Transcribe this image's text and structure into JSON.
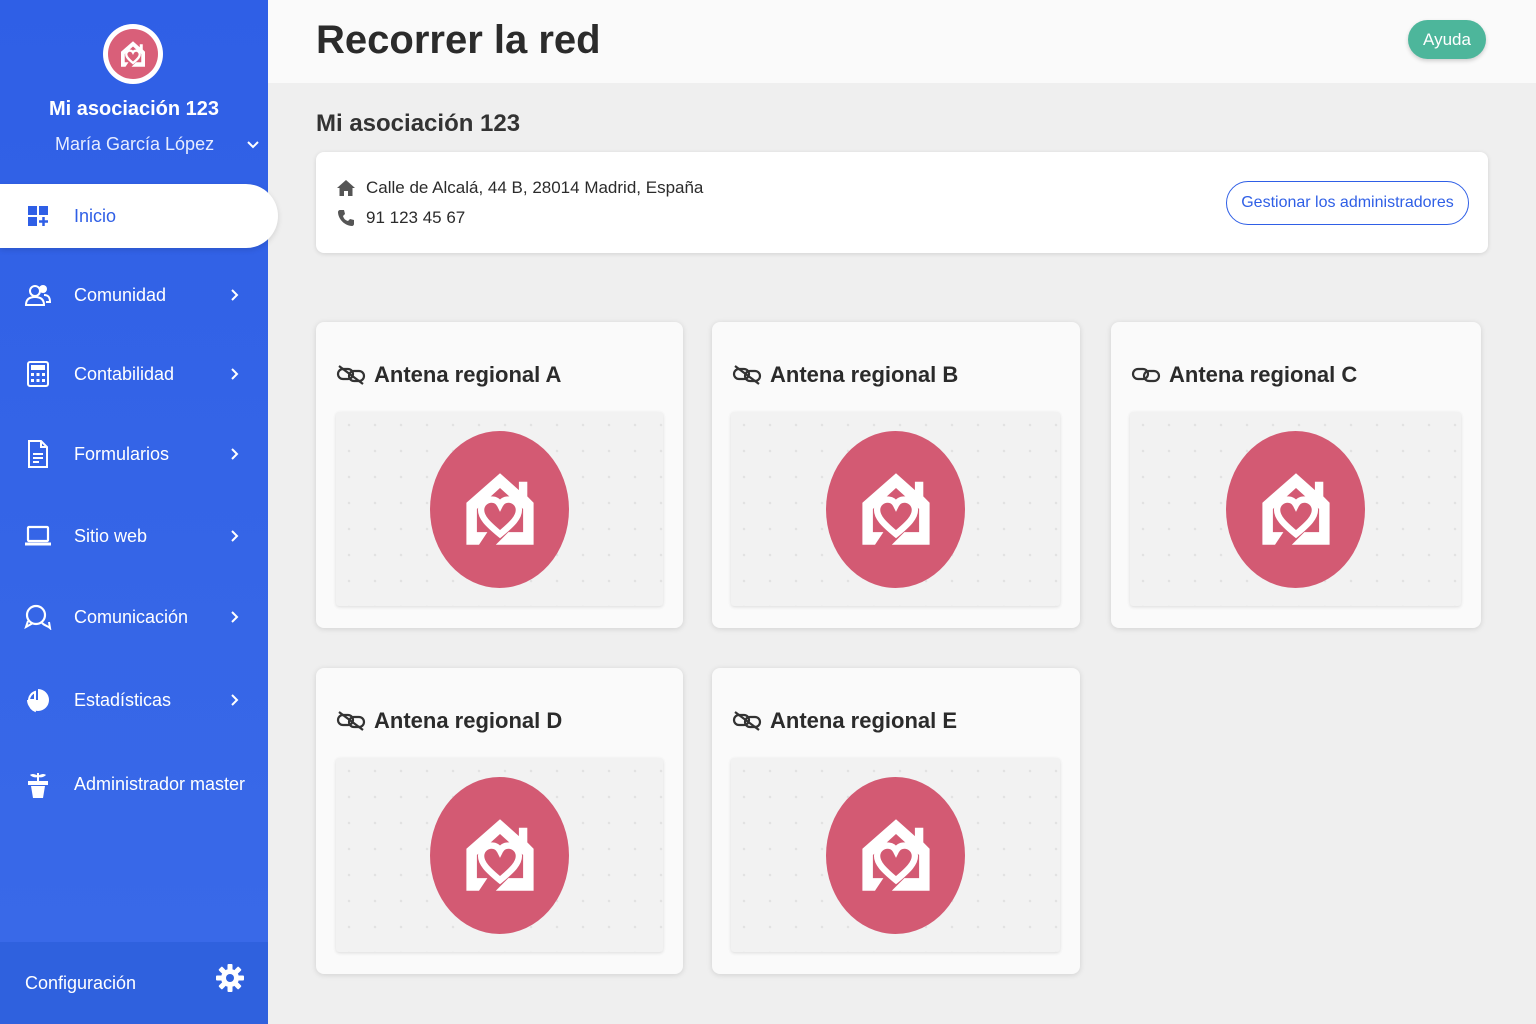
{
  "sidebar": {
    "org_name": "Mi asociación 123",
    "user_name": "María García López",
    "items": [
      {
        "label": "Inicio",
        "icon": "dashboard-icon",
        "active": true
      },
      {
        "label": "Comunidad",
        "icon": "users-icon"
      },
      {
        "label": "Contabilidad",
        "icon": "calculator-icon"
      },
      {
        "label": "Formularios",
        "icon": "document-icon"
      },
      {
        "label": "Sitio web",
        "icon": "laptop-icon"
      },
      {
        "label": "Comunicación",
        "icon": "chat-icon"
      },
      {
        "label": "Estadísticas",
        "icon": "pie-chart-icon"
      },
      {
        "label": "Administrador master",
        "icon": "plant-icon"
      }
    ],
    "footer_label": "Configuración"
  },
  "header": {
    "title": "Recorrer la red",
    "help_label": "Ayuda"
  },
  "main": {
    "section_title": "Mi asociación 123",
    "address": "Calle de Alcalá, 44 B, 28014 Madrid, España",
    "phone": "91 123 45 67",
    "admin_button": "Gestionar los administradores",
    "antennas": [
      {
        "name": "Antena regional A",
        "linked": false
      },
      {
        "name": "Antena regional B",
        "linked": false
      },
      {
        "name": "Antena regional C",
        "linked": true
      },
      {
        "name": "Antena regional D",
        "linked": false
      },
      {
        "name": "Antena regional E",
        "linked": false
      }
    ]
  },
  "colors": {
    "sidebar": "#2f5fe6",
    "accent_pink": "#d35a73",
    "help_green": "#4db69b"
  }
}
